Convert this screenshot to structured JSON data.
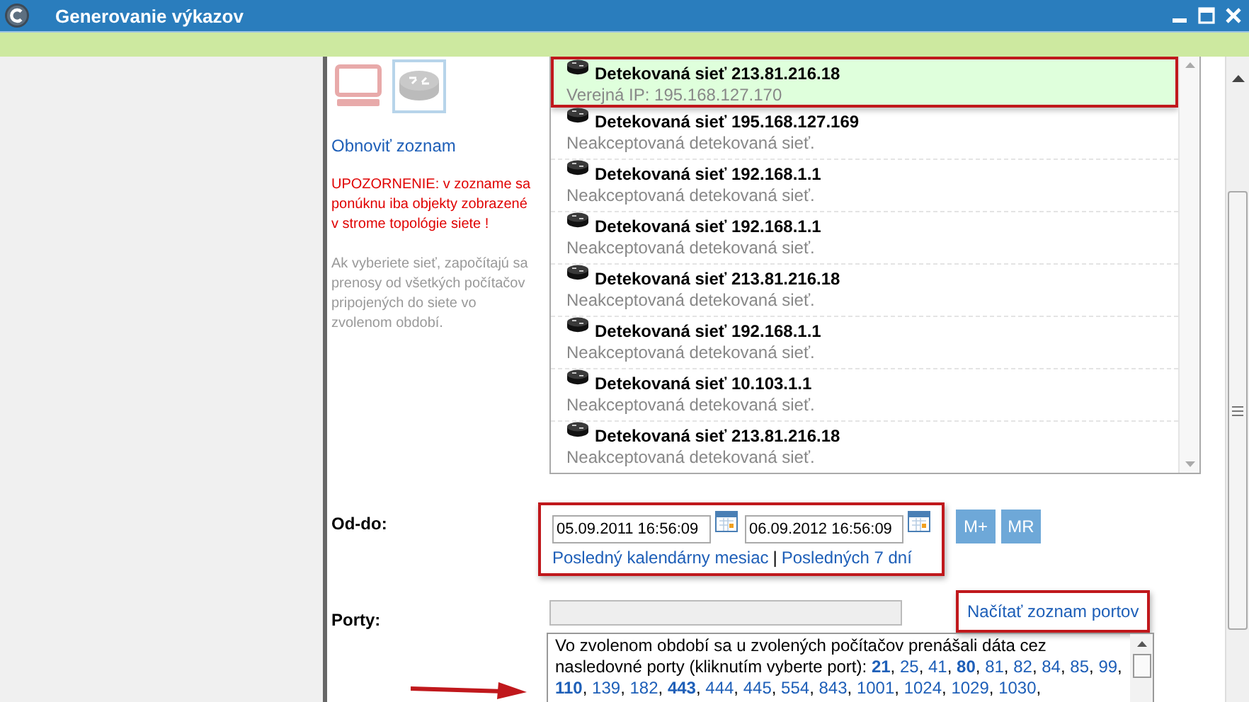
{
  "window": {
    "title": "Generovanie výkazov"
  },
  "type_options": [
    {
      "kind": "computer",
      "selected": false
    },
    {
      "kind": "router",
      "selected": true
    }
  ],
  "refresh_link": "Obnoviť zoznam",
  "warning": "UPOZORNENIE: v zozname sa ponúknu iba objekty zobrazené v strome topológie siete !",
  "hint": "Ak vyberiete sieť, započítajú sa prenosy od všetkých počítačov pripojených do siete vo zvolenom období.",
  "networks": [
    {
      "title": "Detekovaná sieť 213.81.216.18",
      "subtitle": "Verejná IP: 195.168.127.170",
      "selected": true,
      "annotated": true
    },
    {
      "title": "Detekovaná sieť 195.168.127.169",
      "subtitle": "Neakceptovaná detekovaná sieť.",
      "selected": false,
      "annotated": false
    },
    {
      "title": "Detekovaná sieť 192.168.1.1",
      "subtitle": "Neakceptovaná detekovaná sieť.",
      "selected": false,
      "annotated": false
    },
    {
      "title": "Detekovaná sieť 192.168.1.1",
      "subtitle": "Neakceptovaná detekovaná sieť.",
      "selected": false,
      "annotated": false
    },
    {
      "title": "Detekovaná sieť 213.81.216.18",
      "subtitle": "Neakceptovaná detekovaná sieť.",
      "selected": false,
      "annotated": false
    },
    {
      "title": "Detekovaná sieť 192.168.1.1",
      "subtitle": "Neakceptovaná detekovaná sieť.",
      "selected": false,
      "annotated": false
    },
    {
      "title": "Detekovaná sieť 10.103.1.1",
      "subtitle": "Neakceptovaná detekovaná sieť.",
      "selected": false,
      "annotated": false
    },
    {
      "title": "Detekovaná sieť 213.81.216.18",
      "subtitle": "Neakceptovaná detekovaná sieť.",
      "selected": false,
      "annotated": false
    }
  ],
  "period": {
    "label": "Od-do:",
    "from": "05.09.2011 16:56:09",
    "to": "06.09.2012 16:56:09",
    "annotated": true,
    "buttons": [
      "M+",
      "MR"
    ],
    "shortcuts": [
      "Posledný kalendárny mesiac",
      "Posledných 7 dní"
    ],
    "shortcut_separator": "|"
  },
  "ports": {
    "label": "Porty:",
    "load_link": "Načítať zoznam portov",
    "load_annotated": true,
    "intro": "Vo zvolenom období sa u zvolených počítačov prenášali dáta cez nasledovné porty (kliknutím vyberte port):",
    "separator": ",",
    "items": [
      {
        "label": "21",
        "bold": true
      },
      {
        "label": "25",
        "bold": false
      },
      {
        "label": "41",
        "bold": false
      },
      {
        "label": "80",
        "bold": true
      },
      {
        "label": "81",
        "bold": false
      },
      {
        "label": "82",
        "bold": false
      },
      {
        "label": "84",
        "bold": false
      },
      {
        "label": "85",
        "bold": false
      },
      {
        "label": "99",
        "bold": false
      },
      {
        "label": "110",
        "bold": true
      },
      {
        "label": "139",
        "bold": false
      },
      {
        "label": "182",
        "bold": false
      },
      {
        "label": "443",
        "bold": true
      },
      {
        "label": "444",
        "bold": false
      },
      {
        "label": "445",
        "bold": false
      },
      {
        "label": "554",
        "bold": false
      },
      {
        "label": "843",
        "bold": false
      },
      {
        "label": "1001",
        "bold": false
      },
      {
        "label": "1024",
        "bold": false
      },
      {
        "label": "1029",
        "bold": false
      },
      {
        "label": "1030",
        "bold": false
      }
    ]
  }
}
